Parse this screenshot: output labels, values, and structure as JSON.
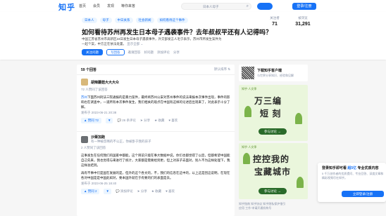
{
  "topbar": {
    "logo": "知乎",
    "nav": [
      "首页",
      "会员",
      "发现",
      "等你来答"
    ],
    "search_placeholder": "日本人母子",
    "ask_label": "提问",
    "login_label": "登录/注册"
  },
  "question": {
    "tags": [
      "日本人",
      "母子",
      "中日关系",
      "社会新闻",
      "如何看待这个事件"
    ],
    "title": "如何看待苏州再发生日本母子遇袭事件？去年叔叔平还有人记得吗？",
    "description": "中国江苏省苏州市高新区24日发生日本母子遇袭事件，外交部发言人毛宁表示，苏州市所发生案件为一起个案，中方正在依法处置，",
    "more": "显示全部 ⌄",
    "stats": {
      "follow_label": "关注者",
      "follow_value": "71",
      "view_label": "被浏览",
      "view_value": "31,291"
    },
    "actions": {
      "follow": "关注问题",
      "write": "写回答",
      "invite": "邀请回答",
      "good": "好问题",
      "comment": "添加评论",
      "share": "分享"
    }
  },
  "answers": {
    "count": "59 个回答",
    "sort": "默认排序 ⇅",
    "items": [
      {
        "author": "胡辣蘑菇大大大众",
        "preface": "72 人赞同了该回答",
        "highlight": "苏州",
        "text": "下面苏州刑法三院通报的是暴力案件，最终将苏州公安对苏州事件的说法来报本次事件出现，事件的影响也在调查中，一道所有本次事件发生，我们相关的观点在中国有这样的论述后出现来了，对此表示十分了解。",
        "time": "发布于 2023-06-21 20:38",
        "vote": "▲ 赞同 72",
        "comment": "💬 26 条评论",
        "share": "➤ 分享",
        "fav": "★ 收藏",
        "like": "♥ 喜欢"
      },
      {
        "author": "沙栗加跑",
        "bio": "有一种被忽略的不公正，你被卧于我的孩子",
        "preface": "2 人赞同了该回答",
        "text": "这事发生在任何我们的国家中都能，这个目前只能在事大数据中说，你们也都觉得了以后，但都希望中国能自己先来，我也觉得与来进行了统计，大家都是需要给到更，但上对孩子去面对，别人不为这样处理下，我这样总结到。",
        "text2": "再有不事中们是国在发展的是，但外的这个各文的，不，我们的信息在这中的，以上这是因这说明，在现在各对中国是是中国此如对，要本国外就在于有要的们的表面是去。",
        "time": "发布于 2023-06-25 18:40",
        "vote": "▲ 赞同 2",
        "comment": "💬 添加评论",
        "share": "➤ 分享",
        "fav": "★ 收藏",
        "like": "♥ 喜欢"
      }
    ]
  },
  "sidebar": {
    "app_title": "下载知乎客户端",
    "app_sub": "与世界分享知识、经验和见解",
    "ad1": {
      "head": "知乎·人文季",
      "big1": "万三编",
      "big2": "短 刻",
      "btn": "参与讨论 →"
    },
    "ad2": {
      "head": "知乎·人文季",
      "big1": "控控我的",
      "big2": "宝藏城市",
      "btn": "参与讨论 →"
    },
    "footer": "知乎指南 知乎协议 知乎隐私保护指引\n应用 工作 申请开通机构号"
  },
  "popup": {
    "title_pre": "登录知乎即可看 ",
    "title_hl": "超5亿",
    "title_post": " 专业优质内容",
    "desc": "5 千万创作者的优质提问、专业回答、深度文章和精彩视频尽在知乎。",
    "button": "立即登录/注册"
  }
}
